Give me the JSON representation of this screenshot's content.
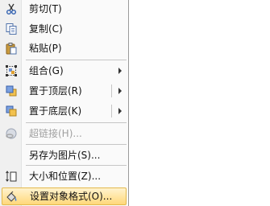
{
  "context_menu": {
    "items": [
      {
        "label": "剪切(T)",
        "icon": "cut-icon",
        "enabled": true,
        "submenu": false
      },
      {
        "label": "复制(C)",
        "icon": "copy-icon",
        "enabled": true,
        "submenu": false
      },
      {
        "label": "粘贴(P)",
        "icon": "paste-icon",
        "enabled": true,
        "submenu": false
      },
      {
        "label": "组合(G)",
        "icon": "group-icon",
        "enabled": true,
        "submenu": true
      },
      {
        "label": "置于顶层(R)",
        "icon": "bring-to-front-icon",
        "enabled": true,
        "submenu": true
      },
      {
        "label": "置于底层(K)",
        "icon": "send-to-back-icon",
        "enabled": true,
        "submenu": true
      },
      {
        "label": "超链接(H)...",
        "icon": "hyperlink-icon",
        "enabled": false,
        "submenu": false
      },
      {
        "label": "另存为图片(S)...",
        "icon": "",
        "enabled": true,
        "submenu": false
      },
      {
        "label": "大小和位置(Z)...",
        "icon": "size-position-icon",
        "enabled": true,
        "submenu": false
      },
      {
        "label": "设置对象格式(O)...",
        "icon": "format-object-icon",
        "enabled": true,
        "submenu": false,
        "highlighted": true
      }
    ]
  },
  "colors": {
    "highlight_top": "#fff3cf",
    "highlight_bottom": "#ffd87a",
    "highlight_border": "#e3b94c",
    "disabled_text": "#a0a0a0"
  }
}
